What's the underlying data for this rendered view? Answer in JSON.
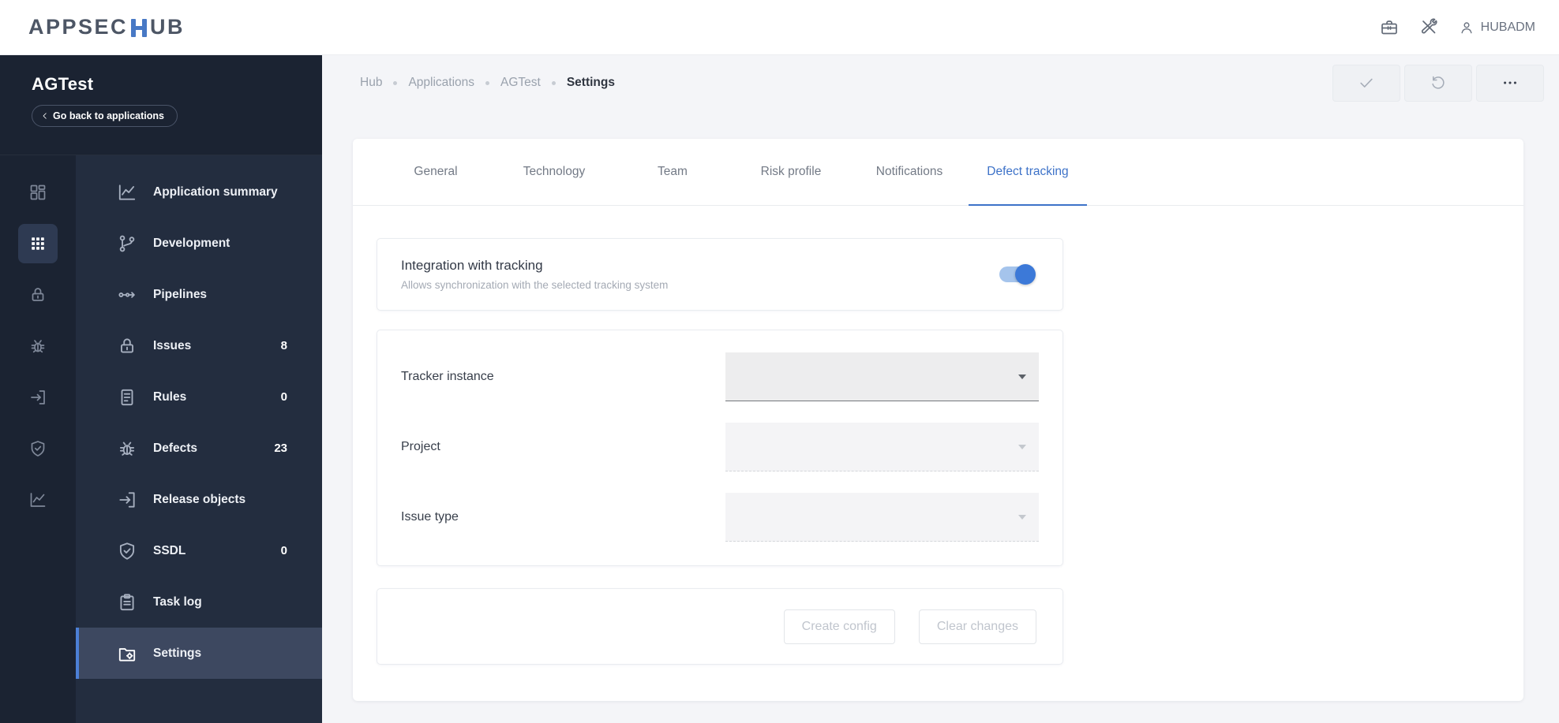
{
  "topbar": {
    "logo_prefix": "APPSEC",
    "logo_suffix": "UB",
    "user_label": "HUBADM"
  },
  "sidebar": {
    "app_title": "AGTest",
    "back_label": "Go back to applications",
    "items": [
      {
        "label": "Application summary",
        "badge": null
      },
      {
        "label": "Development",
        "badge": null
      },
      {
        "label": "Pipelines",
        "badge": null
      },
      {
        "label": "Issues",
        "badge": "8"
      },
      {
        "label": "Rules",
        "badge": "0"
      },
      {
        "label": "Defects",
        "badge": "23"
      },
      {
        "label": "Release objects",
        "badge": null
      },
      {
        "label": "SSDL",
        "badge": "0"
      },
      {
        "label": "Task log",
        "badge": null
      },
      {
        "label": "Settings",
        "badge": null
      }
    ]
  },
  "breadcrumb": {
    "items": [
      "Hub",
      "Applications",
      "AGTest",
      "Settings"
    ]
  },
  "tabs": {
    "items": [
      "General",
      "Technology",
      "Team",
      "Risk profile",
      "Notifications",
      "Defect tracking"
    ],
    "active": "Defect tracking"
  },
  "integration_card": {
    "title": "Integration with tracking",
    "subtitle": "Allows synchronization with the selected tracking system",
    "toggle_state": "on"
  },
  "tracker_form": {
    "fields": [
      {
        "label": "Tracker instance",
        "value": "",
        "enabled": true
      },
      {
        "label": "Project",
        "value": "",
        "enabled": false
      },
      {
        "label": "Issue type",
        "value": "",
        "enabled": false
      }
    ]
  },
  "footer_actions": {
    "create_label": "Create config",
    "clear_label": "Clear changes"
  },
  "colors": {
    "accent_blue": "#3d72c8",
    "toggle_track": "#a5c4ec",
    "toggle_thumb": "#3c79d8",
    "sidebar_dark": "#1b2332",
    "sidebar_menu": "#232d3f",
    "active_row": "#3d4860"
  }
}
